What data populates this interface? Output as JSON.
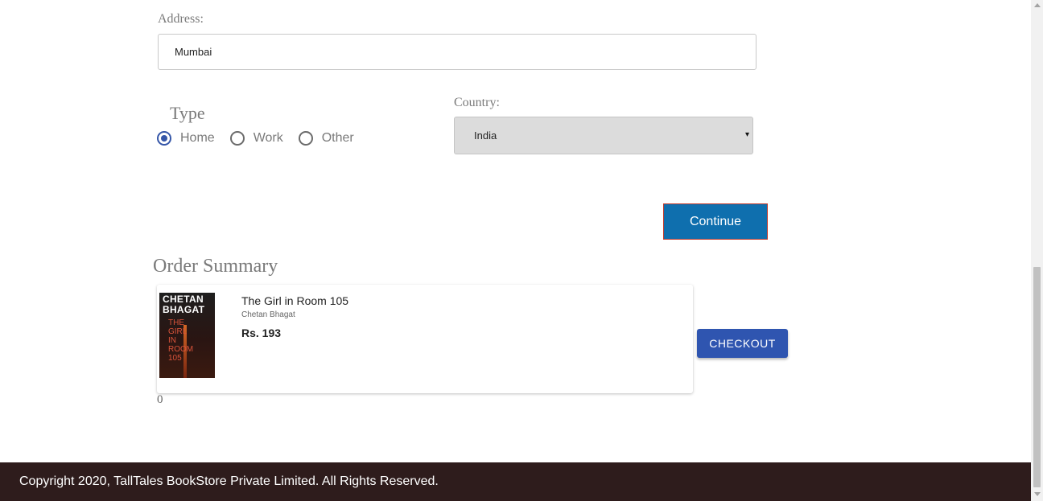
{
  "address": {
    "label": "Address:",
    "value": "Mumbai"
  },
  "type": {
    "title": "Type",
    "options": [
      {
        "label": "Home",
        "checked": true
      },
      {
        "label": "Work",
        "checked": false
      },
      {
        "label": "Other",
        "checked": false
      }
    ]
  },
  "country": {
    "label": "Country:",
    "selected": "India",
    "arrow": "▾"
  },
  "continue_label": "Continue",
  "order_summary": {
    "title": "Order Summary",
    "item": {
      "cover_author": "CHETAN BHAGAT",
      "cover_title": "THE GIRL IN ROOM 105",
      "title": "The Girl in Room 105",
      "author": "Chetan Bhagat",
      "price": "Rs. 193"
    },
    "checkout_label": "CHECKOUT",
    "count": "0"
  },
  "footer": {
    "text": "Copyright 2020, TallTales BookStore Private Limited. All Rights Reserved."
  },
  "colors": {
    "primary_button": "#0f6fae",
    "checkout_button": "#2f55b0",
    "radio_checked": "#3556a8",
    "footer_bg": "#2e1c1c"
  }
}
